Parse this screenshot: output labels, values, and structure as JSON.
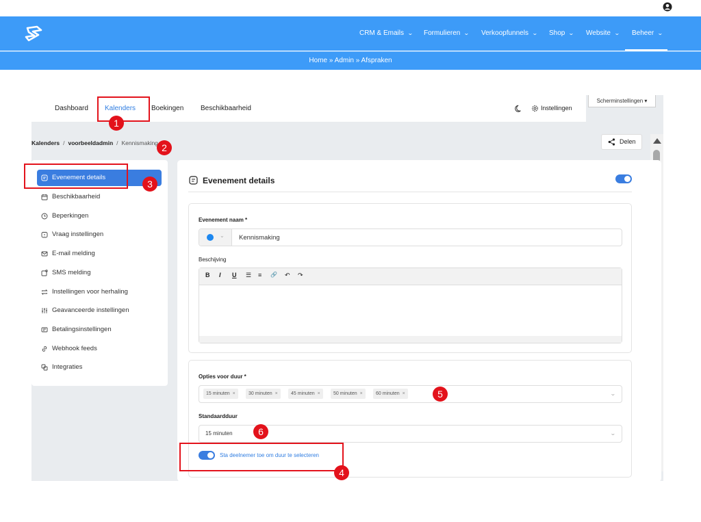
{
  "topbar": {
    "user_icon": "user-circle-icon"
  },
  "nav": {
    "logo": "brand-logo",
    "items": [
      {
        "label": "CRM & Emails",
        "chevron": "⌄"
      },
      {
        "label": "Formulieren",
        "chevron": "⌄"
      },
      {
        "label": "Verkoopfunnels",
        "chevron": "⌄"
      },
      {
        "label": "Shop",
        "chevron": "⌄"
      },
      {
        "label": "Website",
        "chevron": "⌄"
      },
      {
        "label": "Beheer",
        "chevron": "⌄"
      }
    ],
    "active": "Beheer",
    "color": "#3d9bf8"
  },
  "breadcrumb_bar": {
    "text": "Home » Admin » Afspraken"
  },
  "tabs": {
    "items": [
      "Dashboard",
      "Kalenders",
      "Boekingen",
      "Beschikbaarheid"
    ],
    "active": "Kalenders",
    "screen_settings": "Scherminstellingen ▾",
    "settings_label": "Instellingen"
  },
  "crumb": {
    "part1": "Kalenders",
    "sep": "/",
    "part2": "voorbeeldadmin",
    "part3": "Kennismaking"
  },
  "share": {
    "label": "Delen"
  },
  "sidebar": {
    "items": [
      {
        "label": "Evenement details",
        "icon": "form-icon"
      },
      {
        "label": "Beschikbaarheid",
        "icon": "calendar-icon"
      },
      {
        "label": "Beperkingen",
        "icon": "clock-icon"
      },
      {
        "label": "Vraag instellingen",
        "icon": "question-icon"
      },
      {
        "label": "E-mail melding",
        "icon": "mail-icon"
      },
      {
        "label": "SMS melding",
        "icon": "sms-icon"
      },
      {
        "label": "Instellingen voor herhaling",
        "icon": "repeat-icon"
      },
      {
        "label": "Geavanceerde instellingen",
        "icon": "sliders-icon"
      },
      {
        "label": "Betalingsinstellingen",
        "icon": "payment-icon"
      },
      {
        "label": "Webhook feeds",
        "icon": "link-icon"
      },
      {
        "label": "Integraties",
        "icon": "integrations-icon"
      }
    ],
    "active_index": 0
  },
  "card": {
    "title": "Evenement details",
    "enabled": true,
    "name_label": "Evenement naam *",
    "name_value": "Kennismaking",
    "color_value": "#1e88f0",
    "desc_label": "Beschijving",
    "toolbar": [
      "B",
      "I",
      "U",
      "☰",
      "≡",
      "🔗",
      "↶",
      "↷"
    ],
    "duration_label": "Opties voor duur *",
    "duration_options": [
      "15 minuten",
      "30 minuten",
      "45 minuten",
      "50 minuten",
      "60 minuten"
    ],
    "chip_remove": "×",
    "default_label": "Standaardduur",
    "default_value": "15 minuten",
    "allow_label": "Sta deelnemer toe om duur te selecteren",
    "allow_enabled": true
  },
  "annotations": [
    "1",
    "2",
    "3",
    "4",
    "5",
    "6"
  ],
  "accent_color": "#3a7de0",
  "annotation_color": "#e3121b"
}
